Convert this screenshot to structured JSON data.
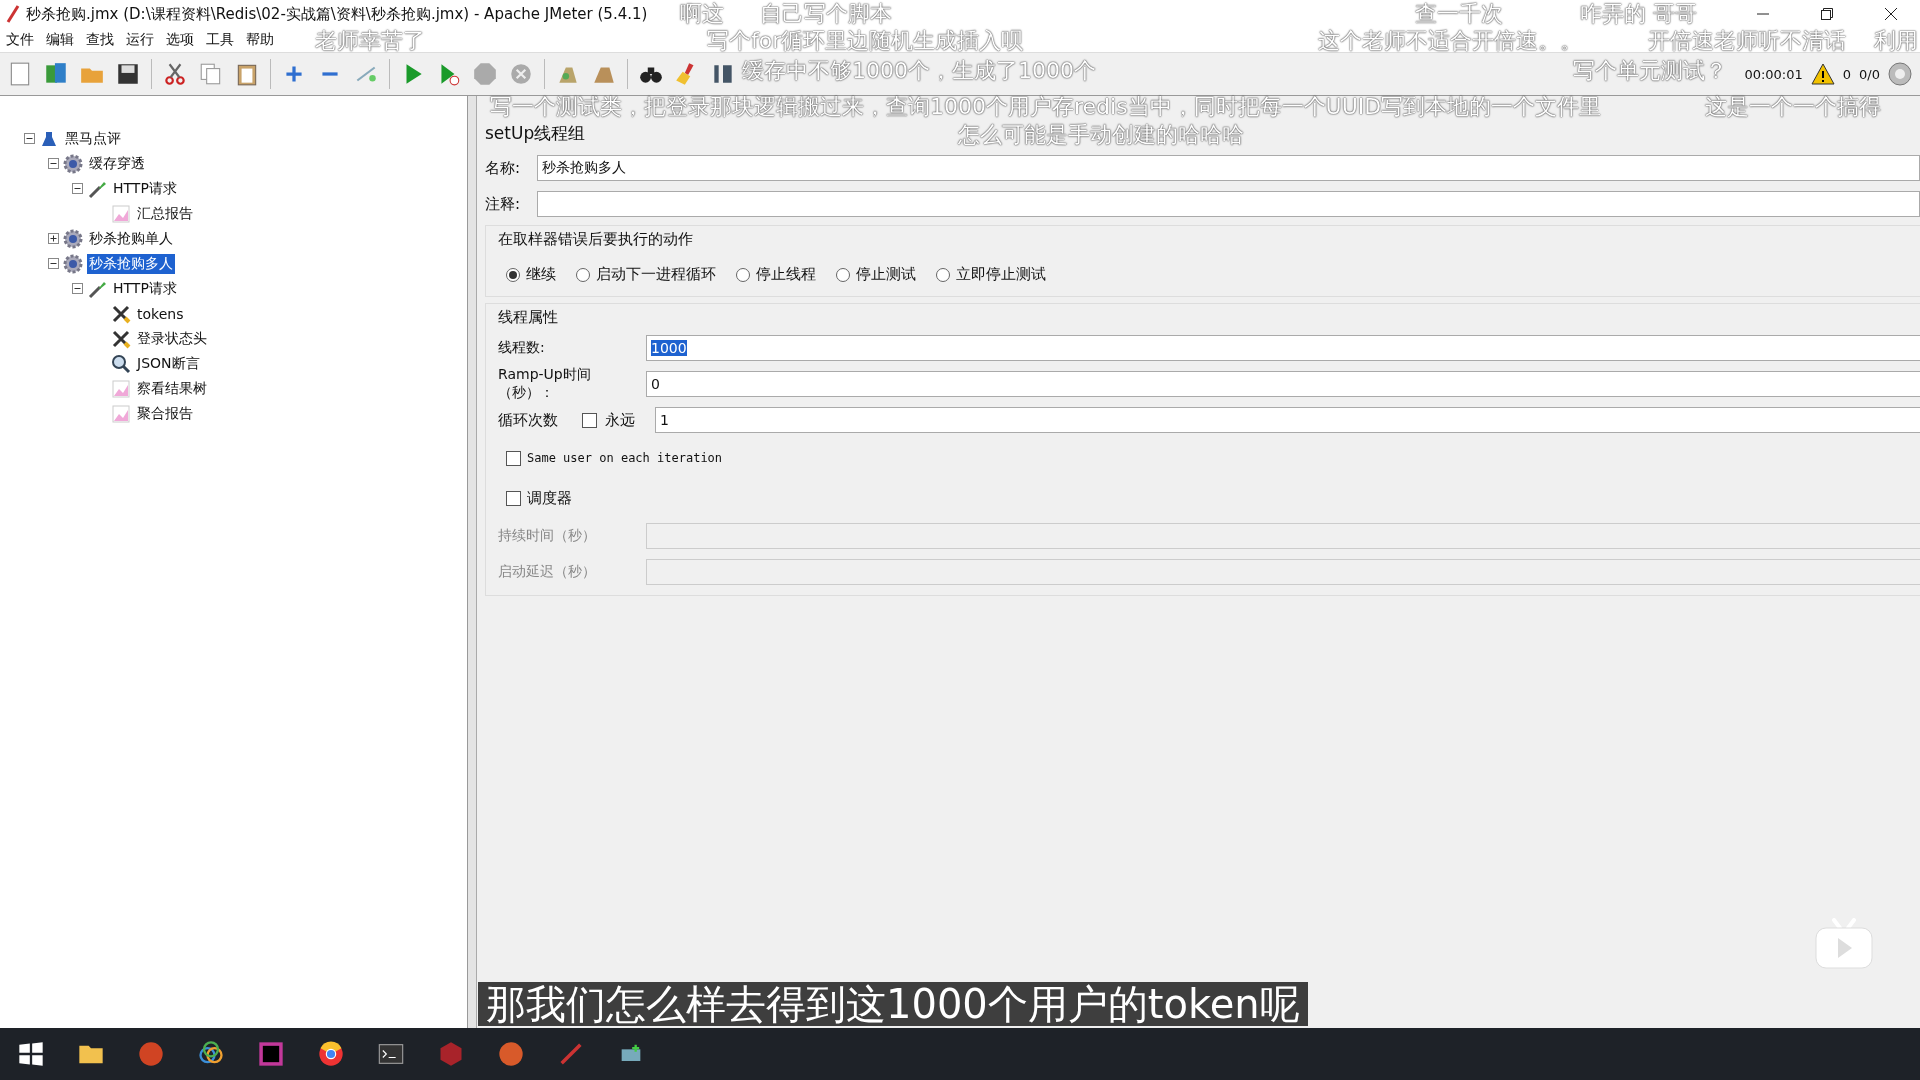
{
  "window": {
    "title": "秒杀抢购.jmx (D:\\课程资料\\Redis\\02-实战篇\\资料\\秒杀抢购.jmx) - Apache JMeter (5.4.1)"
  },
  "menu": [
    "文件",
    "编辑",
    "查找",
    "运行",
    "选项",
    "工具",
    "帮助"
  ],
  "status": {
    "elapsed": "00:00:01",
    "warnings": "0",
    "threads": "0/0"
  },
  "tree": [
    {
      "label": "黑马点评",
      "kind": "plan",
      "expanded": true,
      "selected": false,
      "children": [
        {
          "label": "缓存穿透",
          "kind": "group",
          "expanded": true,
          "selected": false,
          "children": [
            {
              "label": "HTTP请求",
              "kind": "sampler",
              "expanded": true,
              "selected": false,
              "children": [
                {
                  "label": "汇总报告",
                  "kind": "listener",
                  "selected": false
                }
              ]
            }
          ]
        },
        {
          "label": "秒杀抢购单人",
          "kind": "group",
          "expanded": false,
          "selected": false
        },
        {
          "label": "秒杀抢购多人",
          "kind": "group",
          "expanded": true,
          "selected": true,
          "children": [
            {
              "label": "HTTP请求",
              "kind": "sampler",
              "expanded": true,
              "selected": false,
              "children": [
                {
                  "label": "tokens",
                  "kind": "config",
                  "selected": false
                },
                {
                  "label": "登录状态头",
                  "kind": "config",
                  "selected": false
                },
                {
                  "label": "JSON断言",
                  "kind": "assertion",
                  "selected": false
                },
                {
                  "label": "察看结果树",
                  "kind": "listener",
                  "selected": false
                },
                {
                  "label": "聚合报告",
                  "kind": "listener",
                  "selected": false
                }
              ]
            }
          ]
        }
      ]
    }
  ],
  "panel": {
    "title": "setUp线程组",
    "name_label": "名称:",
    "name_value": "秒杀抢购多人",
    "comment_label": "注释:",
    "error_action": {
      "title": "在取样器错误后要执行的动作",
      "options": [
        {
          "label": "继续",
          "selected": true
        },
        {
          "label": "启动下一进程循环",
          "selected": false
        },
        {
          "label": "停止线程",
          "selected": false
        },
        {
          "label": "停止测试",
          "selected": false
        },
        {
          "label": "立即停止测试",
          "selected": false
        }
      ]
    },
    "thread_props": {
      "title": "线程属性",
      "threads_label": "线程数:",
      "threads_value": "1000",
      "threads_value_selected": true,
      "rampup_label": "Ramp-Up时间（秒）：",
      "rampup_value": "0",
      "loop_label": "循环次数",
      "forever_label": "永远",
      "forever_checked": false,
      "loop_value": "1",
      "same_user_label": "Same user on each iteration",
      "same_user_checked": false,
      "scheduler_label": "调度器",
      "scheduler_checked": false,
      "duration_label": "持续时间（秒）",
      "duration_disabled": true,
      "delay_label": "启动延迟（秒）",
      "delay_disabled": true
    }
  },
  "subtitle": "那我们怎么样去得到这1000个用户的token呢",
  "danmaku": [
    {
      "text": "啊这"
    },
    {
      "text": "自己写个脚本"
    },
    {
      "text": "查一千次"
    },
    {
      "text": "咋弄的 哥哥"
    },
    {
      "text": "老师幸苦了"
    },
    {
      "text": "写个for循环里边随机生成插入呗"
    },
    {
      "text": "这个老师不适合开倍速。。"
    },
    {
      "text": "开倍速老师听不清话"
    },
    {
      "text": "利用"
    },
    {
      "text": "缓存中不够1000个，生成了1000个"
    },
    {
      "text": "写个单元测试？"
    },
    {
      "text": "写一个测试类，把登录那块逻辑搬过来，查询1000个用户存redis当中，同时把每一个UUID写到本地的一个文件里"
    },
    {
      "text": "这是一个一个搞得"
    },
    {
      "text": "怎么可能是手动创建的哈哈哈"
    }
  ]
}
